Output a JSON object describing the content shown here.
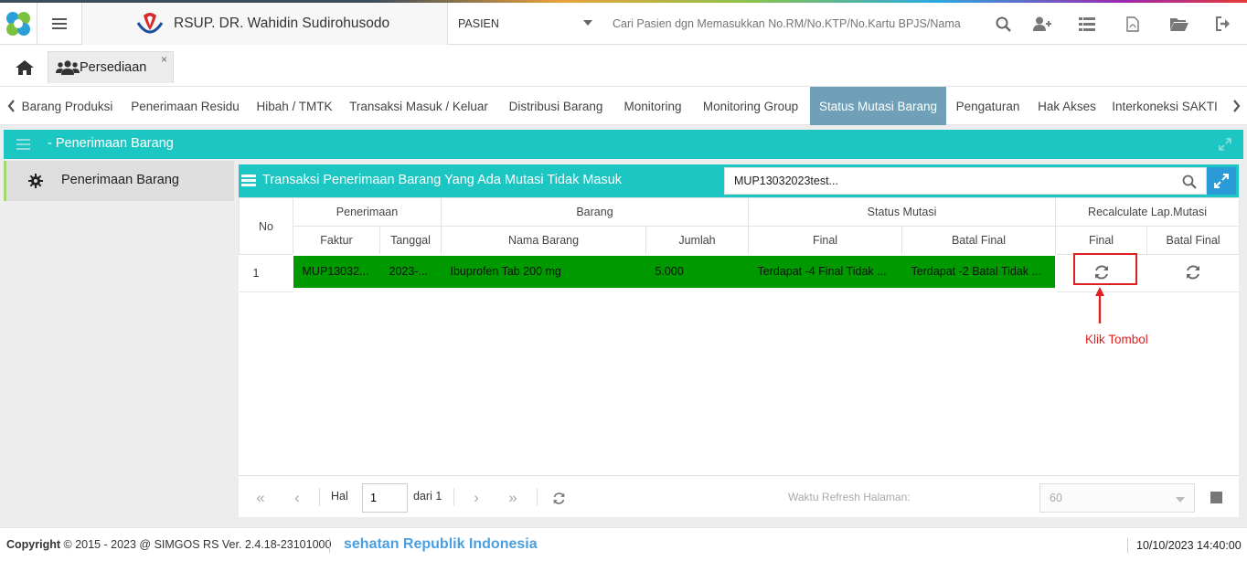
{
  "app": {
    "brand_name": "RSUP. DR. Wahidin Sudirohusodo",
    "patient_select": "PASIEN",
    "patient_search_placeholder": "Cari Pasien dgn Memasukkan No.RM/No.KTP/No.Kartu BPJS/Nama"
  },
  "tabs": {
    "persediaan_label": "Persediaan",
    "close_glyph": "×"
  },
  "nav": {
    "items": [
      "Barang Produksi",
      "Penerimaan Residu",
      "Hibah / TMTK",
      "Transaksi Masuk / Keluar",
      "Distribusi Barang",
      "Monitoring",
      "Monitoring Group",
      "Status Mutasi Barang",
      "Pengaturan",
      "Hak Akses",
      "Interkoneksi SAKTI"
    ],
    "active": "Status Mutasi Barang"
  },
  "panel": {
    "title": "- Penerimaan Barang",
    "menu_item": "Penerimaan Barang"
  },
  "grid": {
    "title": "Transaksi Penerimaan Barang Yang Ada Mutasi Tidak Masuk",
    "search_value": "MUP13032023test...",
    "headers": {
      "no": "No",
      "penerimaan": "Penerimaan",
      "barang": "Barang",
      "status_mutasi": "Status Mutasi",
      "recalculate": "Recalculate Lap.Mutasi",
      "faktur": "Faktur",
      "tanggal": "Tanggal",
      "nama_barang": "Nama Barang",
      "jumlah": "Jumlah",
      "final": "Final",
      "batal_final": "Batal Final",
      "rc_final": "Final",
      "rc_batal_final": "Batal Final"
    },
    "rows": [
      {
        "no": "1",
        "faktur": "MUP13032...",
        "tanggal": "2023-...",
        "nama_barang": "Ibuprofen Tab 200 mg",
        "jumlah": "5.000",
        "final": "Terdapat -4 Final Tidak ...",
        "batal_final": "Terdapat -2 Batal Tidak ..."
      }
    ]
  },
  "annotation": {
    "text": "Klik Tombol",
    "color": "#e01f1f"
  },
  "pager": {
    "hal_label": "Hal",
    "page": "1",
    "of_label": "dari 1",
    "refresh_label": "Waktu Refresh Halaman:",
    "refresh_value": "60"
  },
  "footer": {
    "copyright_bold": "Copyright",
    "copyright_text": "2015 - 2023 @ SIMGOS RS Ver. 2.4.18-23101000",
    "marquee": "sehatan Republik Indonesia",
    "datetime": "10/10/2023 14:40:00"
  },
  "colors": {
    "teal": "#1cc6c3",
    "active_tab": "#6fa0b8",
    "row_green": "#009900",
    "expand_blue": "#2b9bd8"
  }
}
